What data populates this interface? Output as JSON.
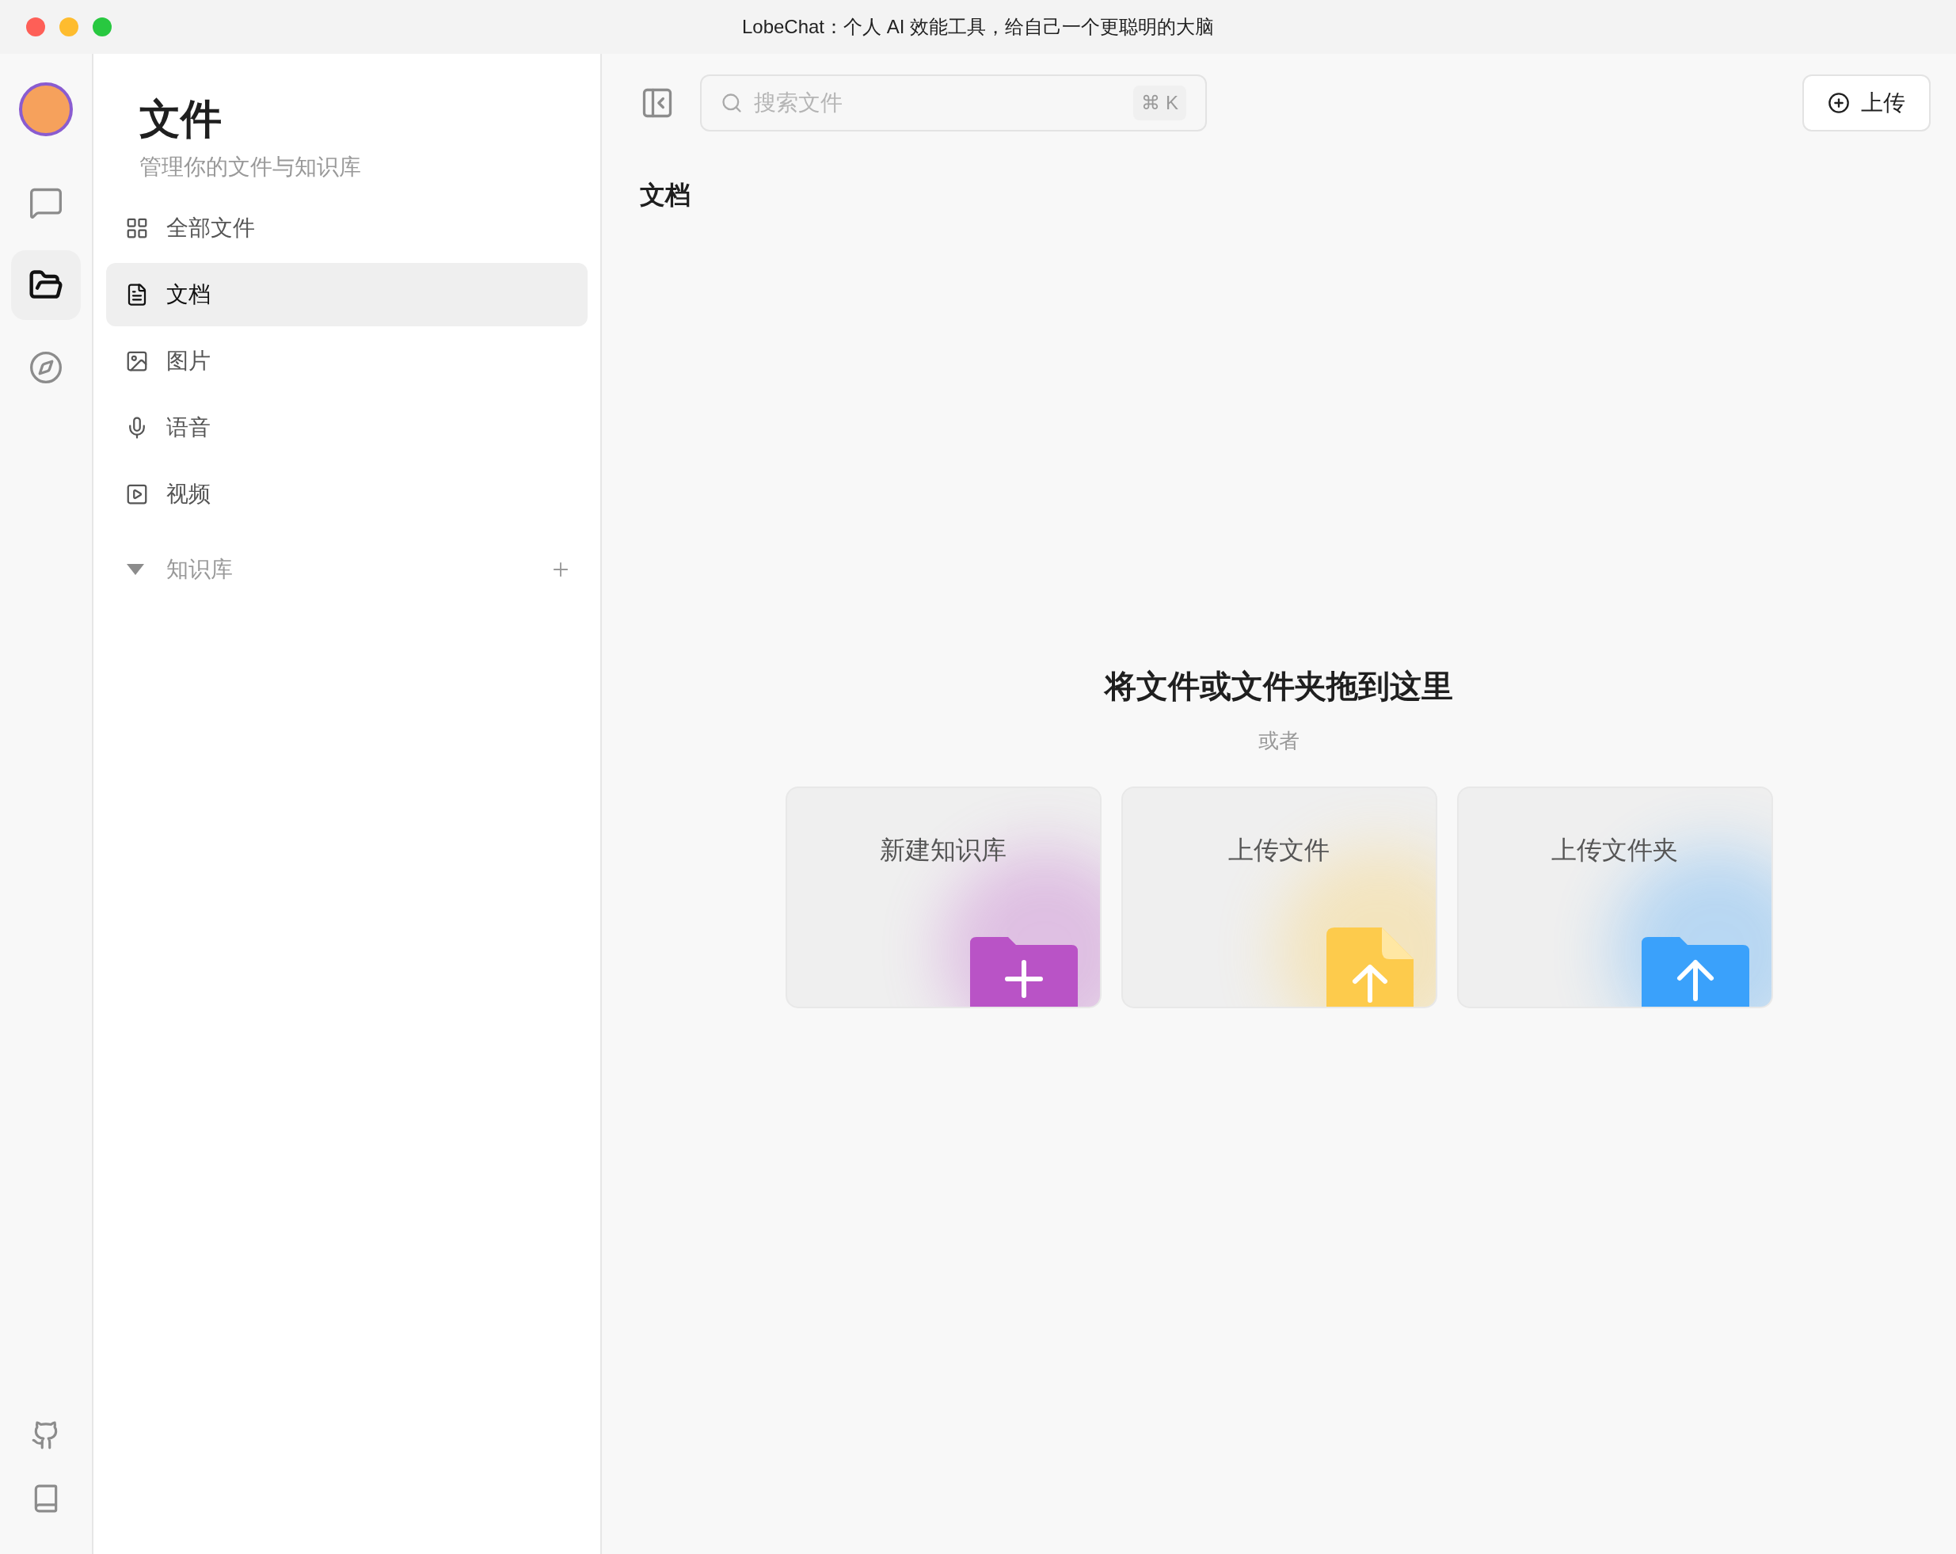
{
  "window": {
    "title": "LobeChat：个人 AI 效能工具，给自己一个更聪明的大脑"
  },
  "rail": {
    "items": [
      {
        "selected": false
      },
      {
        "selected": true
      },
      {
        "selected": false
      }
    ]
  },
  "sidebar": {
    "title": "文件",
    "subtitle": "管理你的文件与知识库",
    "items": [
      {
        "label": "全部文件",
        "selected": false
      },
      {
        "label": "文档",
        "selected": true
      },
      {
        "label": "图片",
        "selected": false
      },
      {
        "label": "语音",
        "selected": false
      },
      {
        "label": "视频",
        "selected": false
      }
    ],
    "knowledge_base": {
      "label": "知识库",
      "expanded": true
    }
  },
  "toolbar": {
    "search": {
      "placeholder": "搜索文件",
      "shortcut": "⌘ K"
    },
    "upload_button": "上传"
  },
  "section_title": "文档",
  "dropzone": {
    "title": "将文件或文件夹拖到这里",
    "or_text": "或者",
    "cards": [
      {
        "label": "新建知识库",
        "kind": "folder_plus",
        "color": "#b953c6"
      },
      {
        "label": "上传文件",
        "kind": "file_up",
        "color": "#fdcb4c"
      },
      {
        "label": "上传文件夹",
        "kind": "folder_up",
        "color": "#3aa1fb"
      }
    ]
  }
}
